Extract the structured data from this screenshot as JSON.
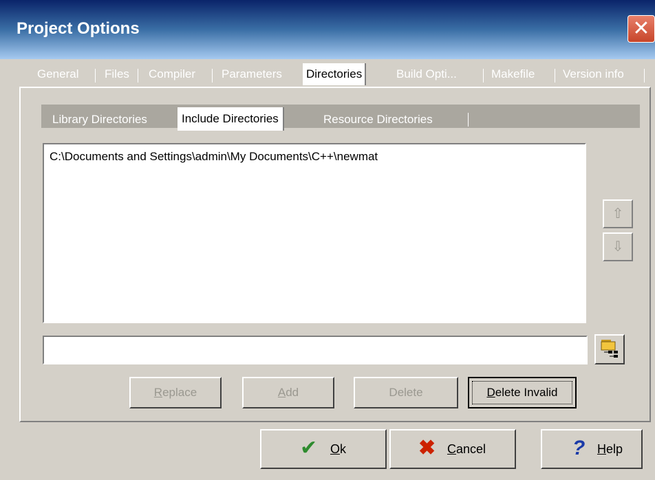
{
  "window": {
    "title": "Project Options"
  },
  "main_tabs": [
    "General",
    "Files",
    "Compiler",
    "Parameters",
    "Directories",
    "Build Opti...",
    "Makefile",
    "Version info"
  ],
  "sub_tabs": [
    "Library Directories",
    "Include Directories",
    "Resource Directories"
  ],
  "directories": [
    "C:\\Documents and Settings\\admin\\My Documents\\C++\\newmat"
  ],
  "path_input": {
    "value": ""
  },
  "buttons": {
    "replace_label": "eplace",
    "replace_key": "R",
    "add_label": "dd",
    "add_key": "A",
    "delete_label": "elete",
    "delete_key": "D",
    "delete_prefix": "De",
    "delete_suffix": "lete",
    "delete_invalid_key": "D",
    "delete_invalid_label": "elete Invalid",
    "ok_key": "O",
    "ok_label": "k",
    "cancel_key": "C",
    "cancel_label": "ancel",
    "help_key": "H",
    "help_label": "elp"
  },
  "icons": {
    "close": "close-icon",
    "up": "arrow-up-icon",
    "down": "arrow-down-icon",
    "browse": "folder-browse-icon",
    "ok": "checkmark-icon",
    "cancel": "x-icon",
    "help": "question-icon"
  },
  "colors": {
    "title_start": "#0a246a",
    "title_end": "#a6caf0",
    "check": "#2e8b2e",
    "x": "#cc2200",
    "question": "#1a3aa8"
  }
}
